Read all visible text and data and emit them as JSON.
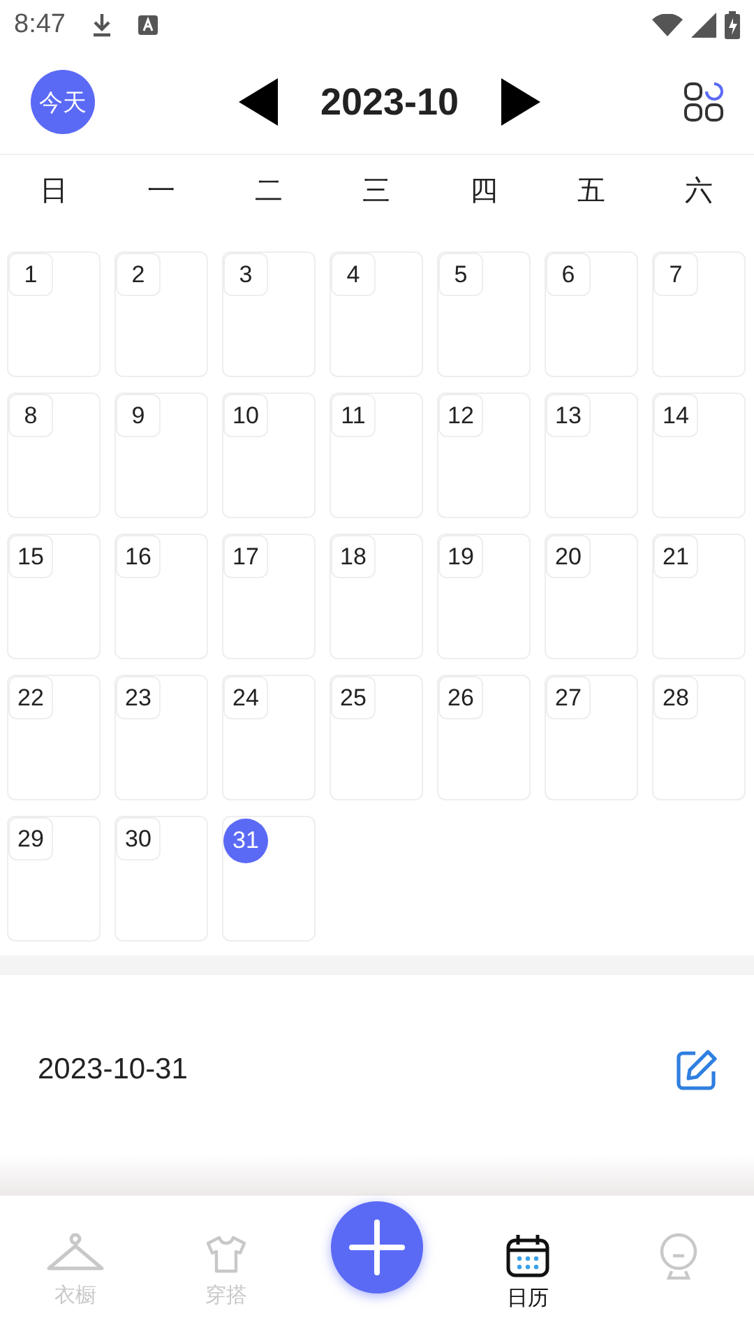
{
  "status_bar": {
    "time": "8:47"
  },
  "header": {
    "today_button": "今天",
    "month": "2023-10"
  },
  "weekdays": [
    "日",
    "一",
    "二",
    "三",
    "四",
    "五",
    "六"
  ],
  "days": [
    {
      "label": "1",
      "selected": false
    },
    {
      "label": "2",
      "selected": false
    },
    {
      "label": "3",
      "selected": false
    },
    {
      "label": "4",
      "selected": false
    },
    {
      "label": "5",
      "selected": false
    },
    {
      "label": "6",
      "selected": false
    },
    {
      "label": "7",
      "selected": false
    },
    {
      "label": "8",
      "selected": false
    },
    {
      "label": "9",
      "selected": false
    },
    {
      "label": "10",
      "selected": false
    },
    {
      "label": "11",
      "selected": false
    },
    {
      "label": "12",
      "selected": false
    },
    {
      "label": "13",
      "selected": false
    },
    {
      "label": "14",
      "selected": false
    },
    {
      "label": "15",
      "selected": false
    },
    {
      "label": "16",
      "selected": false
    },
    {
      "label": "17",
      "selected": false
    },
    {
      "label": "18",
      "selected": false
    },
    {
      "label": "19",
      "selected": false
    },
    {
      "label": "20",
      "selected": false
    },
    {
      "label": "21",
      "selected": false
    },
    {
      "label": "22",
      "selected": false
    },
    {
      "label": "23",
      "selected": false
    },
    {
      "label": "24",
      "selected": false
    },
    {
      "label": "25",
      "selected": false
    },
    {
      "label": "26",
      "selected": false
    },
    {
      "label": "27",
      "selected": false
    },
    {
      "label": "28",
      "selected": false
    },
    {
      "label": "29",
      "selected": false
    },
    {
      "label": "30",
      "selected": false
    },
    {
      "label": "31",
      "selected": true
    }
  ],
  "detail": {
    "date": "2023-10-31"
  },
  "bottom_nav": [
    {
      "kind": "hanger",
      "label": "衣橱",
      "selected": false
    },
    {
      "kind": "shirt",
      "label": "穿搭",
      "selected": false
    },
    {
      "kind": "add"
    },
    {
      "kind": "calendar",
      "label": "日历",
      "selected": true
    },
    {
      "kind": "profile",
      "selected": false
    }
  ]
}
